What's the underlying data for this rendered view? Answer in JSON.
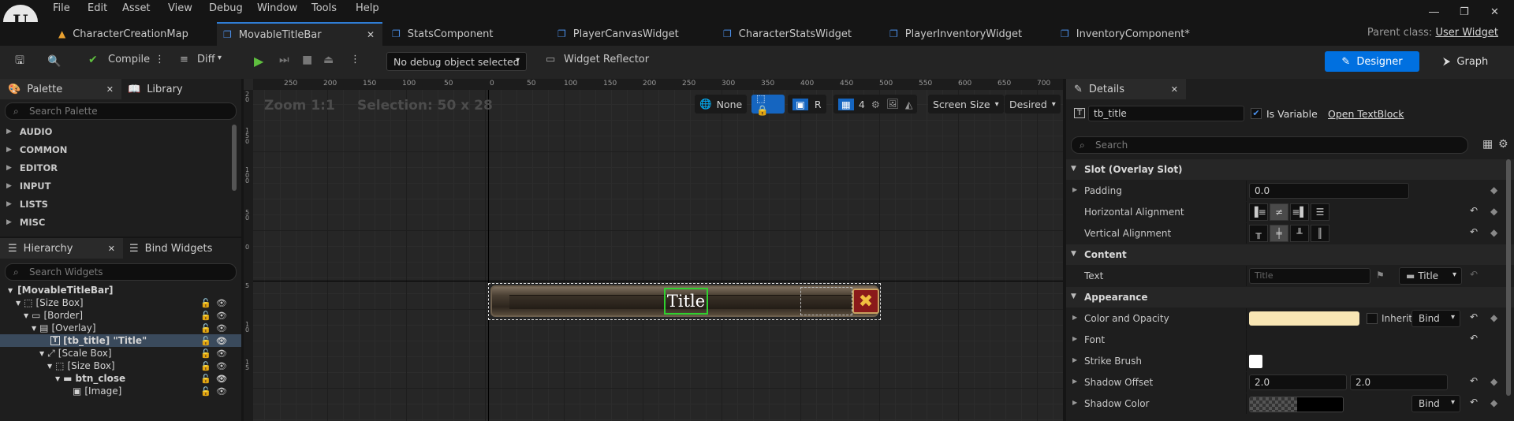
{
  "menu": [
    "File",
    "Edit",
    "Asset",
    "View",
    "Debug",
    "Window",
    "Tools",
    "Help"
  ],
  "tabs": [
    {
      "label": "CharacterCreationMap",
      "icon": "map-icon"
    },
    {
      "label": "MovableTitleBar",
      "icon": "widget-blueprint-icon",
      "active": true
    },
    {
      "label": "StatsComponent",
      "icon": "blueprint-icon"
    },
    {
      "label": "PlayerCanvasWidget",
      "icon": "widget-blueprint-icon"
    },
    {
      "label": "CharacterStatsWidget",
      "icon": "widget-blueprint-icon"
    },
    {
      "label": "PlayerInventoryWidget",
      "icon": "widget-blueprint-icon"
    },
    {
      "label": "InventoryComponent*",
      "icon": "blueprint-icon"
    }
  ],
  "parent_class": {
    "label": "Parent class:",
    "value": "User Widget"
  },
  "toolbar": {
    "compile": "Compile",
    "diff": "Diff",
    "debug_object": "No debug object selected",
    "widget_reflector": "Widget Reflector",
    "designer": "Designer",
    "graph": "Graph"
  },
  "palette": {
    "title": "Palette",
    "library": "Library",
    "search_placeholder": "Search Palette",
    "categories": [
      "AUDIO",
      "COMMON",
      "EDITOR",
      "INPUT",
      "LISTS",
      "MISC"
    ]
  },
  "hierarchy": {
    "title": "Hierarchy",
    "bind": "Bind Widgets",
    "search_placeholder": "Search Widgets",
    "items": [
      {
        "label": "[MovableTitleBar]",
        "bold": true
      },
      {
        "label": "[Size Box]"
      },
      {
        "label": "[Border]"
      },
      {
        "label": "[Overlay]"
      },
      {
        "label": "[tb_title] \"Title\"",
        "bold": true,
        "selected": true
      },
      {
        "label": "[Scale Box]"
      },
      {
        "label": "[Size Box]"
      },
      {
        "label": "btn_close",
        "bold": true
      },
      {
        "label": "[Image]"
      }
    ]
  },
  "canvas": {
    "zoom": "Zoom 1:1",
    "selection": "Selection: 50 x 28",
    "ruler_top": [
      "250",
      "200",
      "150",
      "100",
      "50",
      "0",
      "50",
      "100",
      "150",
      "200",
      "250",
      "300",
      "350",
      "400",
      "450",
      "500",
      "550",
      "600",
      "650",
      "700"
    ],
    "ruler_left": [
      "2\n0",
      "1\n5\n0",
      "1\n0\n0",
      "5\n0",
      "0",
      "5",
      "1\n0",
      "1\n5"
    ],
    "none": "None",
    "r": "R",
    "grid_snap": "4",
    "screen_size": "Screen Size",
    "desired": "Desired",
    "widget_title": "Title"
  },
  "details": {
    "title": "Details",
    "name": "tb_title",
    "is_variable": "Is Variable",
    "open": "Open TextBlock",
    "search_placeholder": "Search",
    "sections": {
      "slot": "Slot (Overlay Slot)",
      "content": "Content",
      "appearance": "Appearance"
    },
    "padding": {
      "label": "Padding",
      "value": "0.0"
    },
    "halign": "Horizontal Alignment",
    "valign": "Vertical Alignment",
    "text": {
      "label": "Text",
      "placeholder": "Title",
      "dropdown": "Title"
    },
    "color": {
      "label": "Color and Opacity",
      "inherit": "Inherit",
      "bind": "Bind",
      "swatch": "#f8e6b4"
    },
    "font": "Font",
    "strike": "Strike Brush",
    "shadow_offset": {
      "label": "Shadow Offset",
      "x": "2.0",
      "y": "2.0"
    },
    "shadow_color": {
      "label": "Shadow Color",
      "bind": "Bind"
    }
  }
}
